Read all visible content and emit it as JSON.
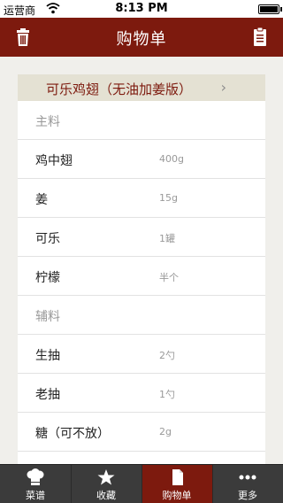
{
  "status_bar": {
    "carrier": "运营商",
    "time": "8:13 PM"
  },
  "nav": {
    "title": "购物单",
    "left_icon": "trash-icon",
    "right_icon": "clipboard-icon"
  },
  "recipe": {
    "name": "可乐鸡翅（无油加姜版）",
    "chevron": "›"
  },
  "ingredients": [
    {
      "name": "主料",
      "amount": "",
      "section": true
    },
    {
      "name": "鸡中翅",
      "amount": "400g"
    },
    {
      "name": "姜",
      "amount": "15g"
    },
    {
      "name": "可乐",
      "amount": "1罐"
    },
    {
      "name": "柠檬",
      "amount": "半个"
    },
    {
      "name": "辅料",
      "amount": "",
      "section": true
    },
    {
      "name": "生抽",
      "amount": "2勺"
    },
    {
      "name": "老抽",
      "amount": "1勺"
    },
    {
      "name": "糖（可不放）",
      "amount": "2g"
    },
    {
      "name": "",
      "amount": ""
    }
  ],
  "tabs": [
    {
      "label": "菜谱",
      "icon": "chef-hat-icon",
      "active": false
    },
    {
      "label": "收藏",
      "icon": "star-icon",
      "active": false
    },
    {
      "label": "购物单",
      "icon": "shopping-list-icon",
      "active": true
    },
    {
      "label": "更多",
      "icon": "more-dots-icon",
      "active": false
    }
  ],
  "colors": {
    "brand": "#7d1a0e",
    "tab_bar": "#3b3b3b",
    "recipe_header_bg": "#e4e1d3"
  }
}
